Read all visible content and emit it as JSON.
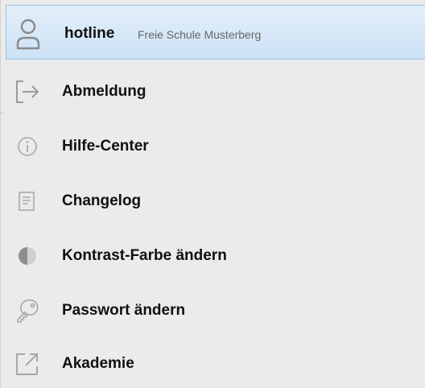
{
  "header": {
    "username": "hotline",
    "organization": "Freie Schule Musterberg",
    "icon": "user-icon"
  },
  "menu": {
    "items": [
      {
        "label": "Abmeldung",
        "icon": "logout-icon"
      },
      {
        "label": "Hilfe-Center",
        "icon": "info-icon"
      },
      {
        "label": "Changelog",
        "icon": "document-icon"
      },
      {
        "label": "Kontrast-Farbe ändern",
        "icon": "contrast-icon"
      },
      {
        "label": "Passwort ändern",
        "icon": "key-icon"
      },
      {
        "label": "Akademie",
        "icon": "external-link-icon"
      }
    ]
  },
  "colors": {
    "menu_background": "#ebebeb",
    "header_background": "#d6e8f8",
    "header_border": "#9cc3e8",
    "icon_gray": "#9a9a9a",
    "text": "#111111",
    "subtext": "#666666"
  }
}
